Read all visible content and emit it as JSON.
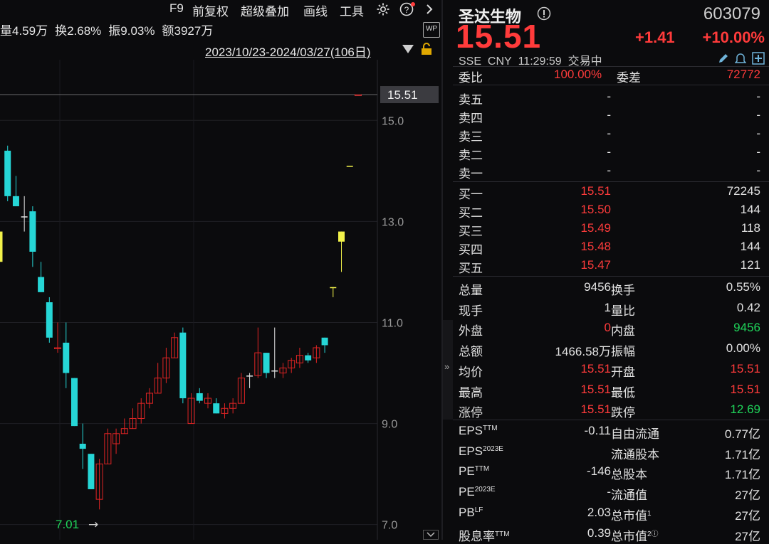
{
  "toolbar": {
    "f9": "F9",
    "adjust": "前复权",
    "overlay": "超级叠加",
    "draw": "画线",
    "tools": "工具"
  },
  "stats": {
    "volume": "量4.59万",
    "turnover": "换2.68%",
    "amplitude": "振9.03%",
    "amount": "额3927万"
  },
  "range": "2023/10/23-2024/03/27(106日)",
  "wp_label": "WP",
  "chart_data": {
    "type": "candlestick",
    "y_ticks": [
      "15.0",
      "13.0",
      "11.0",
      "9.0",
      "7.0"
    ],
    "y_tick_values": [
      15.0,
      13.0,
      11.0,
      9.0,
      7.0
    ],
    "ylim": [
      6.7,
      16.2
    ],
    "last_price_label": "15.51",
    "last_price": 15.51,
    "low_label": "7.01",
    "low_arrow": "→",
    "colors": {
      "up": "#e02424",
      "down": "#26d6d6",
      "highlight": "#f2f24a",
      "ref": "#cc3333"
    },
    "candles": [
      {
        "o": 12.8,
        "c": 12.2,
        "h": 12.9,
        "l": 12.1,
        "kind": "highlight"
      },
      {
        "o": 14.4,
        "c": 13.5,
        "h": 14.5,
        "l": 13.4,
        "kind": "down"
      },
      {
        "o": 13.5,
        "c": 13.3,
        "h": 13.9,
        "l": 13.3,
        "kind": "down"
      },
      {
        "o": 13.1,
        "c": 13.1,
        "h": 13.5,
        "l": 12.8,
        "kind": "doji"
      },
      {
        "o": 13.2,
        "c": 12.4,
        "h": 13.3,
        "l": 12.1,
        "kind": "down"
      },
      {
        "o": 11.9,
        "c": 11.6,
        "h": 12.2,
        "l": 11.6,
        "kind": "down"
      },
      {
        "o": 11.4,
        "c": 10.7,
        "h": 11.5,
        "l": 10.6,
        "kind": "down"
      },
      {
        "o": 10.5,
        "c": 10.5,
        "h": 11.0,
        "l": 10.4,
        "kind": "up"
      },
      {
        "o": 10.6,
        "c": 10.0,
        "h": 11.0,
        "l": 9.7,
        "kind": "down"
      },
      {
        "o": 9.9,
        "c": 8.95,
        "h": 9.9,
        "l": 8.95,
        "kind": "down"
      },
      {
        "o": 8.6,
        "c": 8.5,
        "h": 9.0,
        "l": 8.1,
        "kind": "down"
      },
      {
        "o": 8.4,
        "c": 7.7,
        "h": 8.4,
        "l": 7.7,
        "kind": "down"
      },
      {
        "o": 7.5,
        "c": 8.2,
        "h": 8.3,
        "l": 7.3,
        "kind": "up"
      },
      {
        "o": 8.2,
        "c": 8.8,
        "h": 8.9,
        "l": 8.2,
        "kind": "up"
      },
      {
        "o": 8.6,
        "c": 8.8,
        "h": 8.9,
        "l": 8.4,
        "kind": "up"
      },
      {
        "o": 8.8,
        "c": 8.9,
        "h": 9.1,
        "l": 8.8,
        "kind": "up"
      },
      {
        "o": 8.9,
        "c": 9.1,
        "h": 9.3,
        "l": 8.9,
        "kind": "up"
      },
      {
        "o": 9.1,
        "c": 9.4,
        "h": 9.5,
        "l": 9.0,
        "kind": "up"
      },
      {
        "o": 9.4,
        "c": 9.6,
        "h": 9.7,
        "l": 9.3,
        "kind": "up"
      },
      {
        "o": 9.6,
        "c": 9.9,
        "h": 10.2,
        "l": 9.6,
        "kind": "up"
      },
      {
        "o": 9.9,
        "c": 10.3,
        "h": 10.5,
        "l": 9.8,
        "kind": "up"
      },
      {
        "o": 10.3,
        "c": 10.7,
        "h": 10.8,
        "l": 10.3,
        "kind": "up"
      },
      {
        "o": 10.8,
        "c": 9.5,
        "h": 10.9,
        "l": 9.4,
        "kind": "down"
      },
      {
        "o": 9.0,
        "c": 9.5,
        "h": 9.6,
        "l": 9.0,
        "kind": "up"
      },
      {
        "o": 9.6,
        "c": 9.45,
        "h": 9.7,
        "l": 9.4,
        "kind": "down"
      },
      {
        "o": 9.4,
        "c": 9.5,
        "h": 9.6,
        "l": 9.3,
        "kind": "up"
      },
      {
        "o": 9.4,
        "c": 9.2,
        "h": 9.5,
        "l": 9.2,
        "kind": "down"
      },
      {
        "o": 9.2,
        "c": 9.3,
        "h": 9.4,
        "l": 9.1,
        "kind": "up"
      },
      {
        "o": 9.3,
        "c": 9.4,
        "h": 9.5,
        "l": 9.2,
        "kind": "up"
      },
      {
        "o": 9.4,
        "c": 9.9,
        "h": 10.0,
        "l": 9.4,
        "kind": "up"
      },
      {
        "o": 9.95,
        "c": 9.95,
        "h": 10.0,
        "l": 9.7,
        "kind": "doji"
      },
      {
        "o": 9.95,
        "c": 10.4,
        "h": 10.9,
        "l": 9.9,
        "kind": "up"
      },
      {
        "o": 10.4,
        "c": 10.0,
        "h": 10.4,
        "l": 9.9,
        "kind": "down"
      },
      {
        "o": 10.05,
        "c": 10.05,
        "h": 10.9,
        "l": 9.9,
        "kind": "doji"
      },
      {
        "o": 10.0,
        "c": 10.1,
        "h": 10.2,
        "l": 9.9,
        "kind": "up"
      },
      {
        "o": 10.1,
        "c": 10.25,
        "h": 10.3,
        "l": 10.0,
        "kind": "up"
      },
      {
        "o": 10.2,
        "c": 10.35,
        "h": 10.5,
        "l": 10.1,
        "kind": "up"
      },
      {
        "o": 10.35,
        "c": 10.25,
        "h": 10.4,
        "l": 10.2,
        "kind": "down"
      },
      {
        "o": 10.3,
        "c": 10.5,
        "h": 10.55,
        "l": 10.2,
        "kind": "up"
      },
      {
        "o": 10.55,
        "c": 10.7,
        "h": 10.7,
        "l": 10.4,
        "kind": "down"
      },
      {
        "o": 11.7,
        "c": 11.7,
        "h": 11.7,
        "l": 11.5,
        "kind": "highlight"
      },
      {
        "o": 12.6,
        "c": 12.8,
        "h": 12.8,
        "l": 12.0,
        "kind": "highlight"
      },
      {
        "o": 14.1,
        "c": 14.1,
        "h": 14.1,
        "l": 14.1,
        "kind": "highlight"
      },
      {
        "o": 15.51,
        "c": 15.51,
        "h": 15.51,
        "l": 15.51,
        "kind": "up"
      }
    ]
  },
  "quote": {
    "name": "圣达生物",
    "code": "603079",
    "price": "15.51",
    "change": "+1.41",
    "change_pct": "+10.00%",
    "market": "SSE",
    "currency": "CNY",
    "time": "11:29:59",
    "status": "交易中",
    "ratio_label": "委比",
    "ratio_value": "100.00%",
    "diff_label": "委差",
    "diff_value": "72772",
    "asks": [
      {
        "label": "卖五",
        "price": "-",
        "vol": "-"
      },
      {
        "label": "卖四",
        "price": "-",
        "vol": "-"
      },
      {
        "label": "卖三",
        "price": "-",
        "vol": "-"
      },
      {
        "label": "卖二",
        "price": "-",
        "vol": "-"
      },
      {
        "label": "卖一",
        "price": "-",
        "vol": "-"
      }
    ],
    "bids": [
      {
        "label": "买一",
        "price": "15.51",
        "vol": "72245"
      },
      {
        "label": "买二",
        "price": "15.50",
        "vol": "144"
      },
      {
        "label": "买三",
        "price": "15.49",
        "vol": "118"
      },
      {
        "label": "买四",
        "price": "15.48",
        "vol": "144"
      },
      {
        "label": "买五",
        "price": "15.47",
        "vol": "121"
      }
    ],
    "stats": [
      {
        "l1": "总量",
        "v1": "9456",
        "c1": "",
        "l2": "换手",
        "v2": "0.55%",
        "c2": ""
      },
      {
        "l1": "现手",
        "v1": "1",
        "c1": "",
        "l2": "量比",
        "v2": "0.42",
        "c2": ""
      },
      {
        "l1": "外盘",
        "v1": "0",
        "c1": "red",
        "l2": "内盘",
        "v2": "9456",
        "c2": "green"
      },
      {
        "l1": "总额",
        "v1": "1466.58万",
        "c1": "",
        "l2": "振幅",
        "v2": "0.00%",
        "c2": ""
      },
      {
        "l1": "均价",
        "v1": "15.51",
        "c1": "red",
        "l2": "开盘",
        "v2": "15.51",
        "c2": "red"
      },
      {
        "l1": "最高",
        "v1": "15.51",
        "c1": "red",
        "l2": "最低",
        "v2": "15.51",
        "c2": "red"
      },
      {
        "l1": "涨停",
        "v1": "15.51",
        "c1": "red",
        "l2": "跌停",
        "v2": "12.69",
        "c2": "green"
      }
    ],
    "fin": [
      {
        "l1": "EPS",
        "s1": "TTM",
        "v1": "-0.11",
        "l2": "自由流通",
        "s2": "",
        "v2": "0.77亿"
      },
      {
        "l1": "EPS",
        "s1": "2023E",
        "v1": "",
        "l2": "流通股本",
        "s2": "",
        "v2": "1.71亿"
      },
      {
        "l1": "PE",
        "s1": "TTM",
        "v1": "-146",
        "l2": "总股本",
        "s2": "",
        "v2": "1.71亿"
      },
      {
        "l1": "PE",
        "s1": "2023E",
        "v1": "-",
        "l2": "流通值",
        "s2": "",
        "v2": "27亿"
      },
      {
        "l1": "PB",
        "s1": "LF",
        "v1": "2.03",
        "l2": "总市值",
        "s2": "1",
        "v2": "27亿"
      },
      {
        "l1": "股息率",
        "s1": "TTM",
        "v1": "0.39",
        "l2": "总市值",
        "s2": "2ⓘ",
        "v2": "27亿"
      }
    ]
  }
}
